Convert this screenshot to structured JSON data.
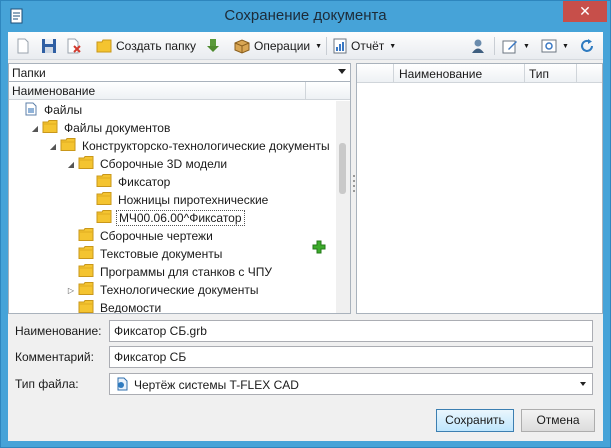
{
  "window": {
    "title": "Сохранение документа",
    "close_glyph": "✕",
    "icon": "document-icon"
  },
  "toolbar": {
    "new_icon": "new-document-icon",
    "save_icon": "save-icon",
    "delete_icon": "delete-icon",
    "create_folder_label": "Создать папку",
    "create_folder_icon": "folder-icon",
    "download_icon": "download-icon",
    "operations_label": "Операции",
    "operations_icon": "box-icon",
    "report_label": "Отчёт",
    "report_icon": "report-icon",
    "user_icon": "user-icon",
    "edit_icon": "edit-icon",
    "view_icon": "view-icon",
    "refresh_icon": "refresh-icon"
  },
  "folders_panel": {
    "combo_value": "Папки",
    "column_header": "Наименование",
    "tree": [
      {
        "label": "Файлы",
        "level": 0,
        "twisty": "",
        "icon": "root-icon"
      },
      {
        "label": "Файлы документов",
        "level": 1,
        "twisty": "◢",
        "icon": "folder-icon"
      },
      {
        "label": "Конструкторско-технологические документы",
        "level": 2,
        "twisty": "◢",
        "icon": "folder-icon"
      },
      {
        "label": "Сборочные 3D модели",
        "level": 3,
        "twisty": "◢",
        "icon": "folder-icon"
      },
      {
        "label": "Фиксатор",
        "level": 4,
        "twisty": "",
        "icon": "folder-icon"
      },
      {
        "label": "Ножницы пиротехнические",
        "level": 4,
        "twisty": "",
        "icon": "folder-icon"
      },
      {
        "label": "МЧ00.06.00^Фиксатор",
        "level": 4,
        "twisty": "",
        "icon": "folder-icon",
        "selected": true
      },
      {
        "label": "Сборочные чертежи",
        "level": 3,
        "twisty": "",
        "icon": "folder-icon"
      },
      {
        "label": "Текстовые документы",
        "level": 3,
        "twisty": "",
        "icon": "folder-icon"
      },
      {
        "label": "Программы для станков с ЧПУ",
        "level": 3,
        "twisty": "",
        "icon": "folder-icon"
      },
      {
        "label": "Технологические документы",
        "level": 3,
        "twisty": "▷",
        "icon": "folder-icon"
      },
      {
        "label": "Ведомости",
        "level": 3,
        "twisty": "",
        "icon": "folder-icon"
      }
    ],
    "add_icon": "add-icon"
  },
  "files_panel": {
    "columns": [
      "Наименование",
      "Тип"
    ]
  },
  "form": {
    "name_label": "Наименование:",
    "name_value": "Фиксатор СБ.grb",
    "comment_label": "Комментарий:",
    "comment_value": "Фиксатор СБ",
    "filetype_label": "Тип файла:",
    "filetype_value": "Чертёж системы T-FLEX CAD",
    "filetype_icon": "tflex-icon"
  },
  "buttons": {
    "save_label": "Сохранить",
    "cancel_label": "Отмена"
  },
  "colors": {
    "titlebar": "#46a3d8",
    "close": "#c74f4a",
    "folder": "#f4c430",
    "add_green": "#3cab2b"
  }
}
